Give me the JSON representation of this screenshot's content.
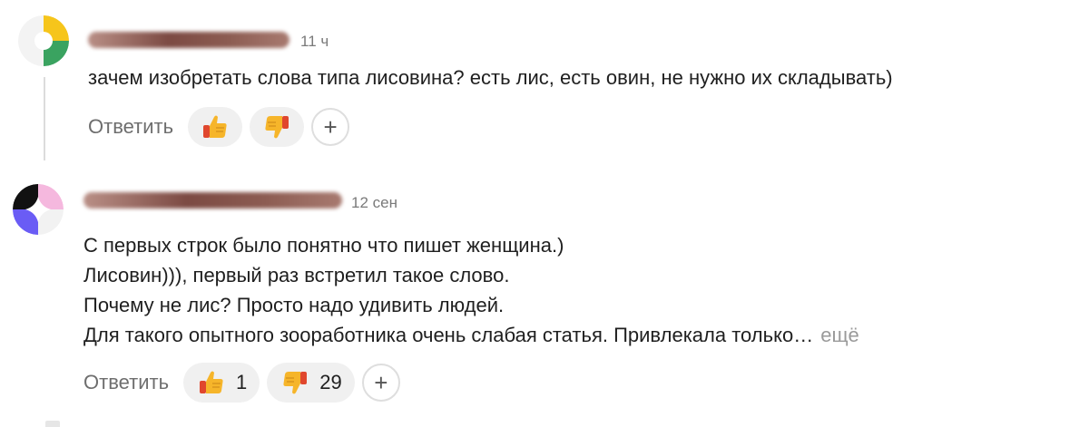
{
  "comments": [
    {
      "time": "11 ч",
      "lines": [
        "зачем изобретать слова типа лисовина? есть лис, есть овин, не нужно их складывать)"
      ],
      "reply_label": "Ответить",
      "likes": "",
      "dislikes": "",
      "add_label": "+"
    },
    {
      "time": "12 сен",
      "lines": [
        "С первых строк было понятно что пишет женщина.)",
        "Лисовин))), первый раз встретил такое слово.",
        "Почему не лис? Просто надо удивить людей.",
        "Для такого опытного зооработника очень слабая статья. Привлекала только…"
      ],
      "more_label": "ещё",
      "reply_label": "Ответить",
      "likes": "1",
      "dislikes": "29",
      "add_label": "+"
    }
  ],
  "icons": {
    "thumb_up": "thumbs-up-icon",
    "thumb_down": "thumbs-down-icon",
    "add": "plus-icon"
  },
  "colors": {
    "reaction_bg": "#f0f0f0",
    "thumb_yellow": "#f6b52a",
    "thumb_red": "#e0472e"
  }
}
